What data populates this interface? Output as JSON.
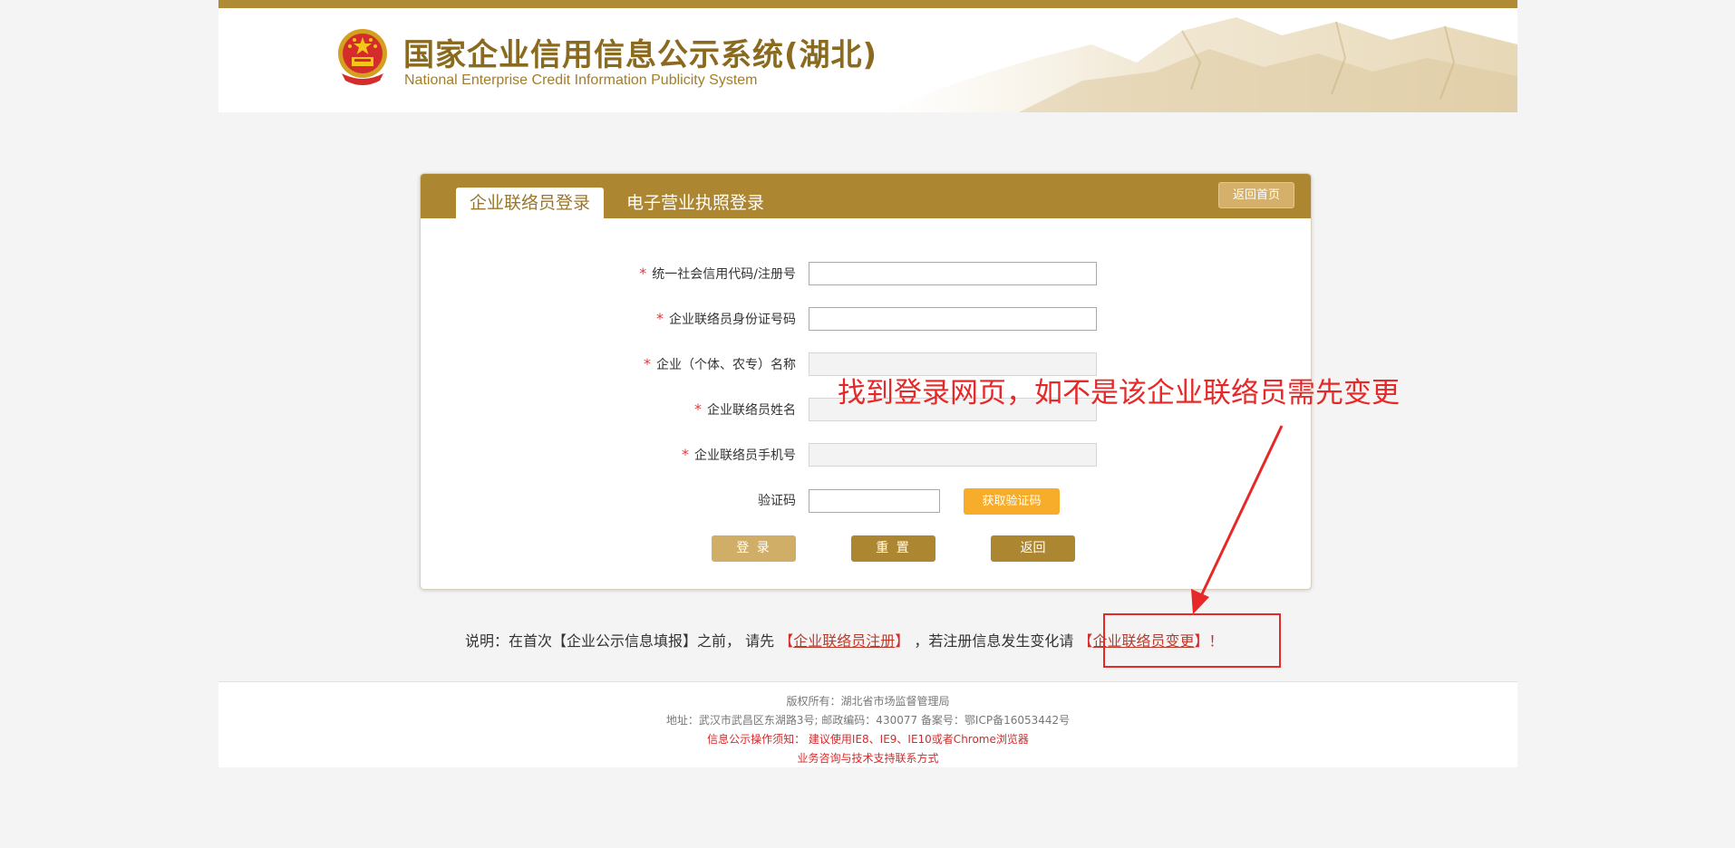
{
  "header": {
    "title_cn": "国家企业信用信息公示系统(湖北)",
    "title_en": "National Enterprise Credit Information Publicity System"
  },
  "login_panel": {
    "tabs": [
      {
        "label": "企业联络员登录",
        "active": true
      },
      {
        "label": "电子营业执照登录",
        "active": false
      }
    ],
    "home_button": "返回首页",
    "fields": [
      {
        "label": "统一社会信用代码/注册号",
        "required": true,
        "value": "",
        "disabled": false
      },
      {
        "label": "企业联络员身份证号码",
        "required": true,
        "value": "",
        "disabled": false
      },
      {
        "label": "企业（个体、农专）名称",
        "required": true,
        "value": "",
        "disabled": true
      },
      {
        "label": "企业联络员姓名",
        "required": true,
        "value": "",
        "disabled": true
      },
      {
        "label": "企业联络员手机号",
        "required": true,
        "value": "",
        "disabled": true
      }
    ],
    "captcha": {
      "label": "验证码",
      "value": "",
      "button": "获取验证码"
    },
    "required_mark": "*",
    "buttons": {
      "login": "登 录",
      "reset": "重 置",
      "back": "返回"
    }
  },
  "notice": {
    "prefix": "说明：在首次【企业公示信息填报】之前， 请先 ",
    "register_open": "【",
    "register_link": "企业联络员注册",
    "register_close": "】",
    "middle": " ，若注册信息发生变化请 ",
    "change_open": "【",
    "change_link": "企业联络员变更",
    "change_close": "】！"
  },
  "footer": {
    "copyright": "版权所有：湖北省市场监督管理局",
    "address": "地址：武汉市武昌区东湖路3号; 邮政编码：430077 备案号：鄂ICP备16053442号",
    "browser_tip": "信息公示操作须知： 建议使用IE8、IE9、IE10或者Chrome浏览器",
    "support": "业务咨询与技术支持联系方式"
  },
  "annotation": {
    "text": "找到登录网页，如不是该企业联络员需先变更",
    "color": "#e62828"
  },
  "colors": {
    "brand_gold": "#ad8631",
    "accent_orange": "#f8ad2a",
    "required_red": "#e0393e"
  }
}
